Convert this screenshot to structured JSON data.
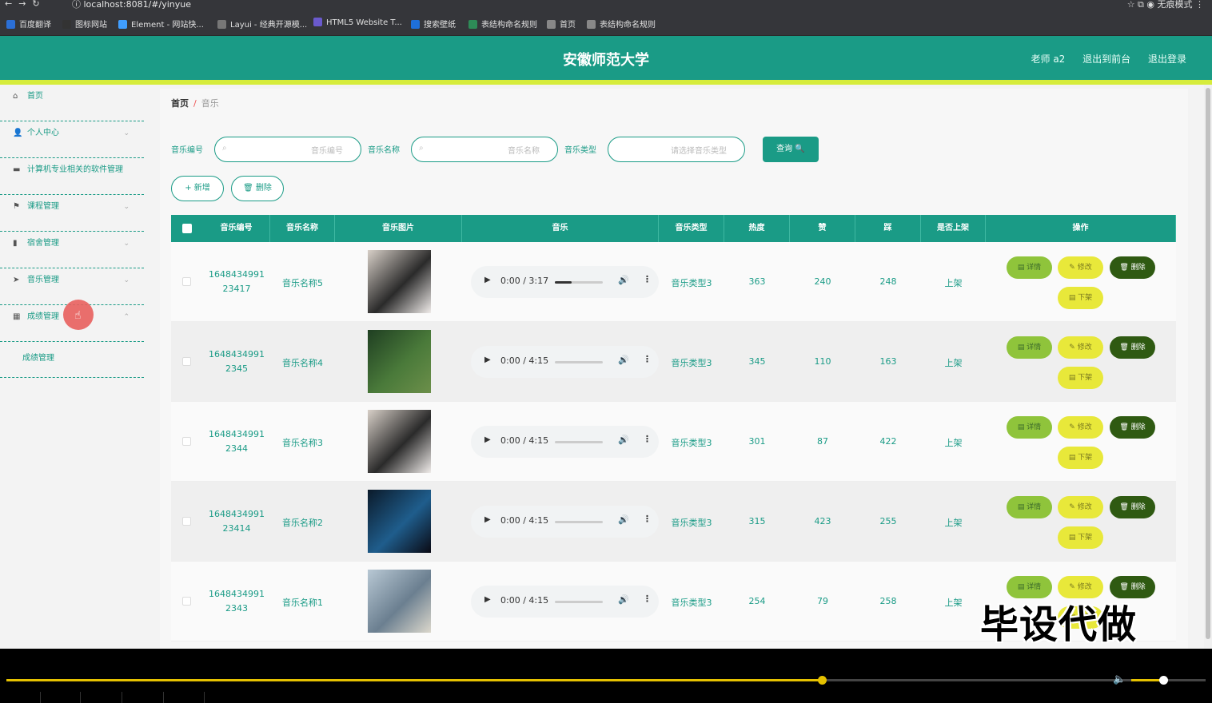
{
  "browser": {
    "url": "localhost:8081/#/yinyue",
    "mode": "无痕模式"
  },
  "bookmarks": [
    {
      "label": "百度翻译",
      "color": "#2b6fd6"
    },
    {
      "label": "图标网站",
      "color": "#333333"
    },
    {
      "label": "Element - 网站快...",
      "color": "#409eff"
    },
    {
      "label": "Layui - 经典开源模...",
      "color": "#777777"
    },
    {
      "label": "HTML5 Website T...",
      "color": "#6a5acd"
    },
    {
      "label": "搜索壁纸",
      "color": "#1e6fd9"
    },
    {
      "label": "表结构命名规则",
      "color": "#2e8b57"
    },
    {
      "label": "首页",
      "color": "#888888"
    },
    {
      "label": "表结构命名规则",
      "color": "#888888"
    }
  ],
  "header": {
    "title": "安徽师范大学",
    "user": "老师 a2",
    "exit_front": "退出到前台",
    "logout": "退出登录"
  },
  "sidebar": {
    "items": [
      {
        "label": "首页",
        "icon": "⌂"
      },
      {
        "label": "个人中心",
        "icon": "👤",
        "chevron": "⌄"
      },
      {
        "label": "计算机专业相关的软件管理",
        "icon": "▬"
      },
      {
        "label": "课程管理",
        "icon": "⚑",
        "chevron": "⌄"
      },
      {
        "label": "宿舍管理",
        "icon": "▮",
        "chevron": "⌄"
      },
      {
        "label": "音乐管理",
        "icon": "➤",
        "chevron": "⌄"
      },
      {
        "label": "成绩管理",
        "icon": "▦",
        "chevron": "⌃"
      }
    ],
    "submenu": "成绩管理"
  },
  "breadcrumb": {
    "home": "首页",
    "sep": "/",
    "current": "音乐"
  },
  "search": {
    "code_label": "音乐编号",
    "code_placeholder": "音乐编号",
    "name_label": "音乐名称",
    "name_placeholder": "音乐名称",
    "type_label": "音乐类型",
    "type_placeholder": "请选择音乐类型",
    "query": "查询 🔍"
  },
  "actions": {
    "add": "+ 新增",
    "delete": "🗑 删除"
  },
  "table": {
    "headers": [
      "音乐编号",
      "音乐名称",
      "音乐图片",
      "音乐",
      "音乐类型",
      "热度",
      "赞",
      "踩",
      "是否上架",
      "操作"
    ],
    "btn_detail": "▤ 详情",
    "btn_edit": "✎ 修改",
    "btn_remove": "🗑 删除",
    "btn_down": "▤ 下架",
    "rows": [
      {
        "code1": "1648434991",
        "code2": "23417",
        "name": "音乐名称5",
        "time": "0:00 / 3:17",
        "progress": 0.35,
        "type": "音乐类型3",
        "heat": "363",
        "like": "240",
        "dislike": "248",
        "status": "上架",
        "pic_colors": [
          "#d8d0c8",
          "#2a2a2a",
          "#f0ecea"
        ]
      },
      {
        "code1": "1648434991",
        "code2": "2345",
        "name": "音乐名称4",
        "time": "0:00 / 4:15",
        "progress": 0,
        "type": "音乐类型3",
        "heat": "345",
        "like": "110",
        "dislike": "163",
        "status": "上架",
        "pic_colors": [
          "#1f3f22",
          "#4a7a3a",
          "#6c8f4a"
        ]
      },
      {
        "code1": "1648434991",
        "code2": "2344",
        "name": "音乐名称3",
        "time": "0:00 / 4:15",
        "progress": 0,
        "type": "音乐类型3",
        "heat": "301",
        "like": "87",
        "dislike": "422",
        "status": "上架",
        "pic_colors": [
          "#d8d0c8",
          "#2a2a2a",
          "#f0ecea"
        ]
      },
      {
        "code1": "1648434991",
        "code2": "23414",
        "name": "音乐名称2",
        "time": "0:00 / 4:15",
        "progress": 0,
        "type": "音乐类型3",
        "heat": "315",
        "like": "423",
        "dislike": "255",
        "status": "上架",
        "pic_colors": [
          "#0b1a2a",
          "#1f5d8c",
          "#0a0a14"
        ]
      },
      {
        "code1": "1648434991",
        "code2": "2343",
        "name": "音乐名称1",
        "time": "0:00 / 4:15",
        "progress": 0,
        "type": "音乐类型3",
        "heat": "254",
        "like": "79",
        "dislike": "258",
        "status": "上架",
        "pic_colors": [
          "#b8c8d4",
          "#6b7f90",
          "#dcd8cc"
        ]
      }
    ]
  },
  "watermark": "毕设代做",
  "video_player": {
    "played": 0.68,
    "volume": 0.45
  }
}
